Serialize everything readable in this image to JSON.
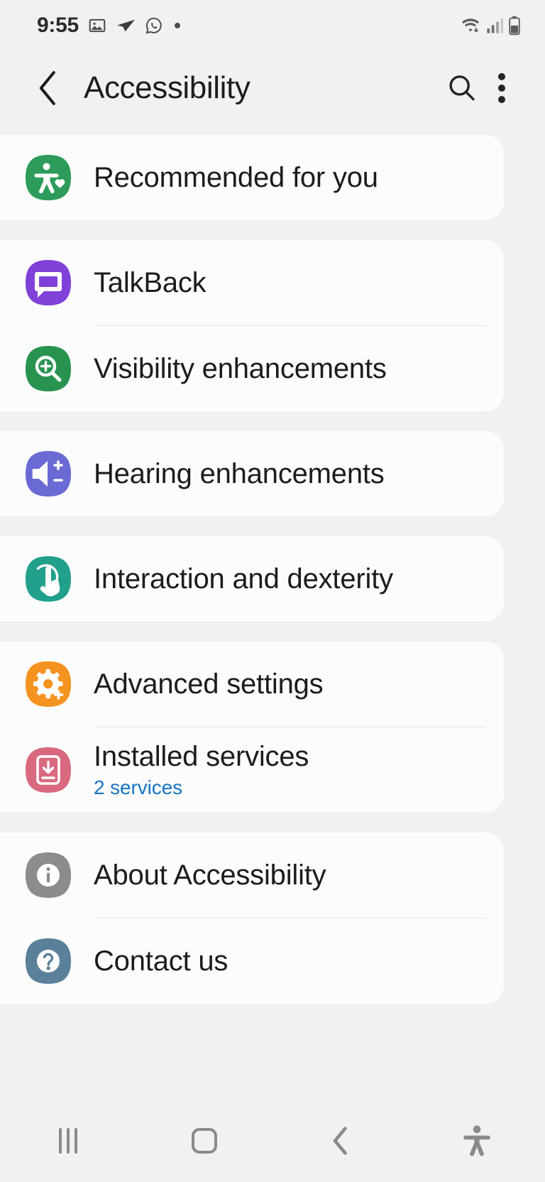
{
  "status_bar": {
    "time": "9:55",
    "left_icons": [
      "image-icon",
      "telegram-icon",
      "whatsapp-icon",
      "dot-icon"
    ],
    "right_icons": [
      "wifi-icon",
      "cellular-signal-icon",
      "battery-icon"
    ]
  },
  "app_bar": {
    "back_icon": "back-chevron-icon",
    "title": "Accessibility",
    "search_icon": "search-icon",
    "more_icon": "more-options-icon"
  },
  "colors": {
    "page_background": "#f1f1f1",
    "card_background": "#fcfcfc",
    "title_text": "#1c1c1c",
    "subtitle_link": "#1774c4",
    "divider": "#e7e7e7",
    "icon_recommended": "#2d9c5a",
    "icon_talkback": "#8041d9",
    "icon_visibility": "#28934f",
    "icon_hearing": "#6a6ad4",
    "icon_interaction": "#22a08c",
    "icon_advanced": "#f59320",
    "icon_installed": "#d9697f",
    "icon_about": "#8c8c8c",
    "icon_contact": "#5b8099"
  },
  "groups": [
    {
      "name": "recommended-group",
      "items": [
        {
          "label": "Recommended for you",
          "icon": "accessibility-person-heart-icon",
          "color": "#2d9c5a",
          "subtitle": null
        }
      ]
    },
    {
      "name": "vision-group",
      "items": [
        {
          "label": "TalkBack",
          "icon": "speech-bubble-icon",
          "color": "#8041d9",
          "subtitle": null
        },
        {
          "label": "Visibility enhancements",
          "icon": "magnifier-plus-icon",
          "color": "#28934f",
          "subtitle": null
        }
      ]
    },
    {
      "name": "hearing-group",
      "items": [
        {
          "label": "Hearing enhancements",
          "icon": "speaker-plus-minus-icon",
          "color": "#6a6ad4",
          "subtitle": null
        }
      ]
    },
    {
      "name": "interaction-group",
      "items": [
        {
          "label": "Interaction and dexterity",
          "icon": "hand-tap-icon",
          "color": "#22a08c",
          "subtitle": null
        }
      ]
    },
    {
      "name": "advanced-group",
      "items": [
        {
          "label": "Advanced settings",
          "icon": "gear-plus-icon",
          "color": "#f59320",
          "subtitle": null
        },
        {
          "label": "Installed services",
          "icon": "download-box-icon",
          "color": "#d9697f",
          "subtitle": "2 services"
        }
      ]
    },
    {
      "name": "about-group",
      "items": [
        {
          "label": "About Accessibility",
          "icon": "info-icon",
          "color": "#8c8c8c",
          "subtitle": null
        },
        {
          "label": "Contact us",
          "icon": "question-mark-icon",
          "color": "#5b8099",
          "subtitle": null
        }
      ]
    }
  ],
  "nav_bar": {
    "recents_label": "recents-button",
    "home_label": "home-button",
    "back_label": "back-button",
    "accessibility_label": "accessibility-shortcut-button"
  }
}
